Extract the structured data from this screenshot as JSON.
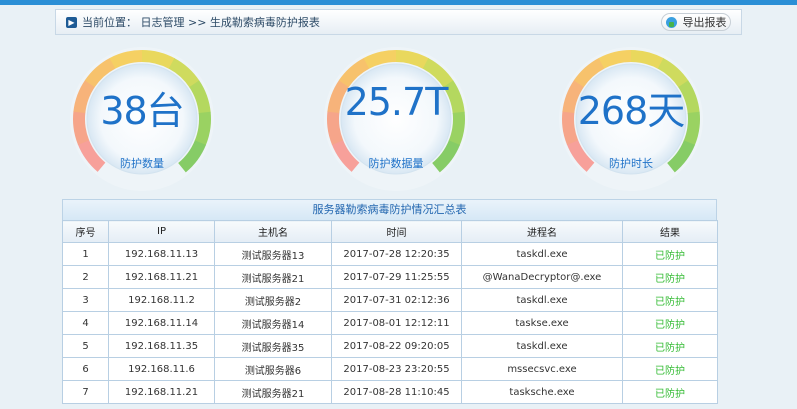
{
  "breadcrumb": {
    "text": "当前位置：  日志管理 >> 生成勒索病毒防护报表"
  },
  "export_button": {
    "label": "导出报表"
  },
  "gauges": [
    {
      "value": "38台",
      "label": "防护数量"
    },
    {
      "value": "25.7T",
      "label": "防护数据量"
    },
    {
      "value": "268天",
      "label": "防护时长"
    }
  ],
  "table": {
    "title": "服务器勒索病毒防护情况汇总表",
    "headers": [
      "序号",
      "IP",
      "主机名",
      "时间",
      "进程名",
      "结果"
    ],
    "rows": [
      [
        "1",
        "192.168.11.13",
        "测试服务器13",
        "2017-07-28 12:20:35",
        "taskdl.exe",
        "已防护"
      ],
      [
        "2",
        "192.168.11.21",
        "测试服务器21",
        "2017-07-29 11:25:55",
        "@WanaDecryptor@.exe",
        "已防护"
      ],
      [
        "3",
        "192.168.11.2",
        "测试服务器2",
        "2017-07-31 02:12:36",
        "taskdl.exe",
        "已防护"
      ],
      [
        "4",
        "192.168.11.14",
        "测试服务器14",
        "2017-08-01 12:12:11",
        "taskse.exe",
        "已防护"
      ],
      [
        "5",
        "192.168.11.35",
        "测试服务器35",
        "2017-08-22 09:20:05",
        "taskdl.exe",
        "已防护"
      ],
      [
        "6",
        "192.168.11.6",
        "测试服务器6",
        "2017-08-23 23:20:55",
        "mssecsvc.exe",
        "已防护"
      ],
      [
        "7",
        "192.168.11.21",
        "测试服务器21",
        "2017-08-28 11:10:45",
        "tasksche.exe",
        "已防护"
      ]
    ]
  }
}
